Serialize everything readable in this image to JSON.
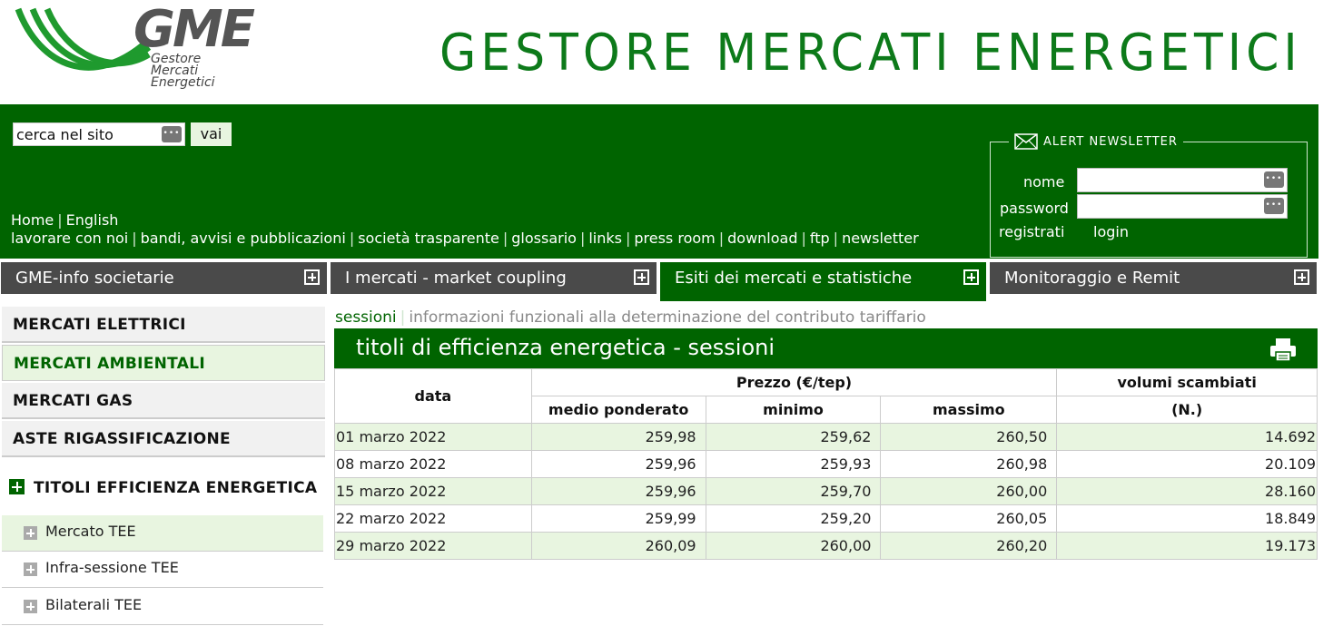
{
  "header": {
    "logo_text": "GME",
    "logo_sub": [
      "Gestore",
      "Mercati",
      "Energetici"
    ],
    "site_title": "GESTORE MERCATI ENERGETICI"
  },
  "search": {
    "value": "cerca nel sito",
    "button": "vai"
  },
  "top_links_1": [
    "Home",
    "English"
  ],
  "top_links_2": [
    "lavorare con noi",
    "bandi, avvisi e pubblicazioni",
    "società trasparente",
    "glossario",
    "links",
    "press room",
    "download",
    "ftp",
    "newsletter"
  ],
  "newsletter": {
    "title": "ALERT NEWSLETTER",
    "name_label": "nome",
    "password_label": "password",
    "register": "registrati",
    "login": "login"
  },
  "nav": [
    {
      "label": "GME-info societarie",
      "active": false
    },
    {
      "label": "I mercati - market coupling",
      "active": false
    },
    {
      "label": "Esiti dei mercati e statistiche",
      "active": true
    },
    {
      "label": "Monitoraggio e Remit",
      "active": false
    }
  ],
  "sidebar": {
    "main": [
      {
        "label": "MERCATI ELETTRICI",
        "active": false
      },
      {
        "label": "MERCATI AMBIENTALI",
        "active": true
      },
      {
        "label": "MERCATI GAS",
        "active": false
      },
      {
        "label": "ASTE RIGASSIFICAZIONE",
        "active": false
      }
    ],
    "section": "TITOLI EFFICIENZA ENERGETICA",
    "sub": [
      {
        "label": "Mercato TEE",
        "active": true
      },
      {
        "label": "Infra-sessione TEE",
        "active": false
      },
      {
        "label": "Bilaterali TEE",
        "active": false
      }
    ]
  },
  "breadcrumb": {
    "current": "sessioni",
    "other": "informazioni funzionali alla determinazione del contributo tariffario"
  },
  "content": {
    "title": "titoli di efficienza energetica - sessioni",
    "table": {
      "col_date": "data",
      "col_price_group": "Prezzo (€/tep)",
      "col_avg": "medio ponderato",
      "col_min": "minimo",
      "col_max": "massimo",
      "col_volume": "volumi scambiati",
      "col_volume_unit": "(N.)",
      "rows": [
        [
          "01 marzo 2022",
          "259,98",
          "259,62",
          "260,50",
          "14.692"
        ],
        [
          "08 marzo 2022",
          "259,96",
          "259,93",
          "260,98",
          "20.109"
        ],
        [
          "15 marzo 2022",
          "259,96",
          "259,70",
          "260,00",
          "28.160"
        ],
        [
          "22 marzo 2022",
          "259,99",
          "259,20",
          "260,05",
          "18.849"
        ],
        [
          "29 marzo 2022",
          "260,09",
          "260,00",
          "260,20",
          "19.173"
        ]
      ]
    }
  },
  "colors": {
    "brand_green": "#006400",
    "title_green": "#0d7a1a",
    "row_tint": "#e8f5e0",
    "nav_gray": "#4a4a4a"
  }
}
